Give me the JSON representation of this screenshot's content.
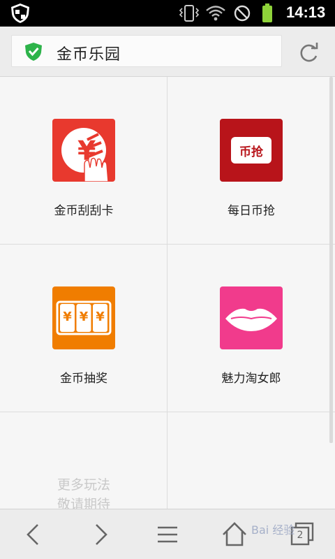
{
  "status_bar": {
    "time": "14:13",
    "icons": [
      "shield-icon",
      "vibrate-icon",
      "wifi-icon",
      "no-signal-icon",
      "battery-icon"
    ]
  },
  "url_bar": {
    "title": "金币乐园",
    "secure_color": "#2db34a",
    "icons": [
      "shield-check-icon",
      "reload-icon"
    ]
  },
  "grid": {
    "items": [
      {
        "label": "金币刮刮卡",
        "icon": "scratch-card-icon",
        "color": "#e8392e"
      },
      {
        "label": "每日币抢",
        "icon": "daily-grab-icon",
        "color": "#b8141a",
        "badge": "币抢"
      },
      {
        "label": "金币抽奖",
        "icon": "slot-machine-icon",
        "color": "#f07d00",
        "symbol": "¥"
      },
      {
        "label": "魅力淘女郎",
        "icon": "lips-icon",
        "color": "#f13b8c"
      }
    ],
    "more": {
      "line1": "更多玩法",
      "line2": "敬请期待"
    }
  },
  "nav_bar": {
    "buttons": [
      "back-icon",
      "forward-icon",
      "menu-icon",
      "home-icon",
      "tabs-icon"
    ],
    "tabs_count": "2"
  },
  "watermark": "Bai 经验"
}
